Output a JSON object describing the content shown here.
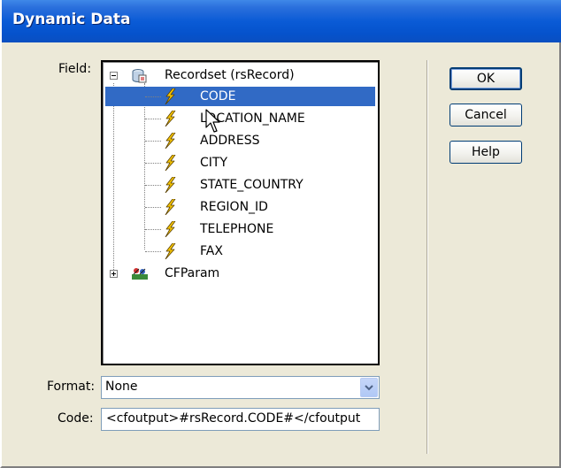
{
  "window": {
    "title": "Dynamic Data"
  },
  "field_label": "Field:",
  "tree": {
    "root": {
      "label": "Recordset (rsRecord)",
      "icon": "recordset-icon",
      "expanded": true
    },
    "columns": [
      {
        "label": "CODE",
        "selected": true
      },
      {
        "label": "LOCATION_NAME",
        "selected": false
      },
      {
        "label": "ADDRESS",
        "selected": false
      },
      {
        "label": "CITY",
        "selected": false
      },
      {
        "label": "STATE_COUNTRY",
        "selected": false
      },
      {
        "label": "REGION_ID",
        "selected": false
      },
      {
        "label": "TELEPHONE",
        "selected": false
      },
      {
        "label": "FAX",
        "selected": false
      }
    ],
    "param": {
      "label": "CFParam",
      "icon": "cfparam-icon",
      "expanded": false
    }
  },
  "buttons": {
    "ok": "OK",
    "cancel": "Cancel",
    "help": "Help"
  },
  "format": {
    "label": "Format:",
    "value": "None"
  },
  "code": {
    "label": "Code:",
    "value": "<cfoutput>#rsRecord.CODE#</cfoutput"
  },
  "colors": {
    "title_bar": "#0a5bd6",
    "selection": "#316ac5",
    "dialog_bg": "#ece9d8",
    "bolt": "#f5c400"
  }
}
